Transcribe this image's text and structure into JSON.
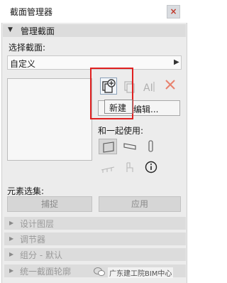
{
  "window": {
    "title": "截面管理器",
    "close_symbol": "×"
  },
  "manage_section": {
    "title": "管理截面",
    "caret": "▼"
  },
  "select_section": {
    "label": "选择截面:",
    "selected": "自定义",
    "arrow": "▶"
  },
  "toolbar": {
    "new_icon": "new-section-icon",
    "copy_icon": "duplicate-icon",
    "rename_icon": "rename-text-icon",
    "delete_icon": "delete-icon",
    "rename_glyph": "AI"
  },
  "edit_button": {
    "label": "编辑..."
  },
  "tooltip": {
    "text": "新建"
  },
  "use_with": {
    "label": "和一起使用:",
    "info_symbol": "ⓘ"
  },
  "element_set": {
    "label": "元素选集:",
    "capture_label": "捕捉",
    "apply_label": "应用"
  },
  "collapsed_sections": [
    {
      "label": "设计图层",
      "caret": "▶"
    },
    {
      "label": "调节器",
      "caret": "▶"
    },
    {
      "label": "组分 - 默认",
      "caret": "▶"
    },
    {
      "label": "统一截面轮廓",
      "caret": "▶"
    }
  ],
  "watermark": {
    "text": "广东建工院BIM中心"
  },
  "colors": {
    "highlight": "#e02020",
    "delete": "#e8826e",
    "panel": "#ececec",
    "section_header": "#dcdcdc"
  }
}
